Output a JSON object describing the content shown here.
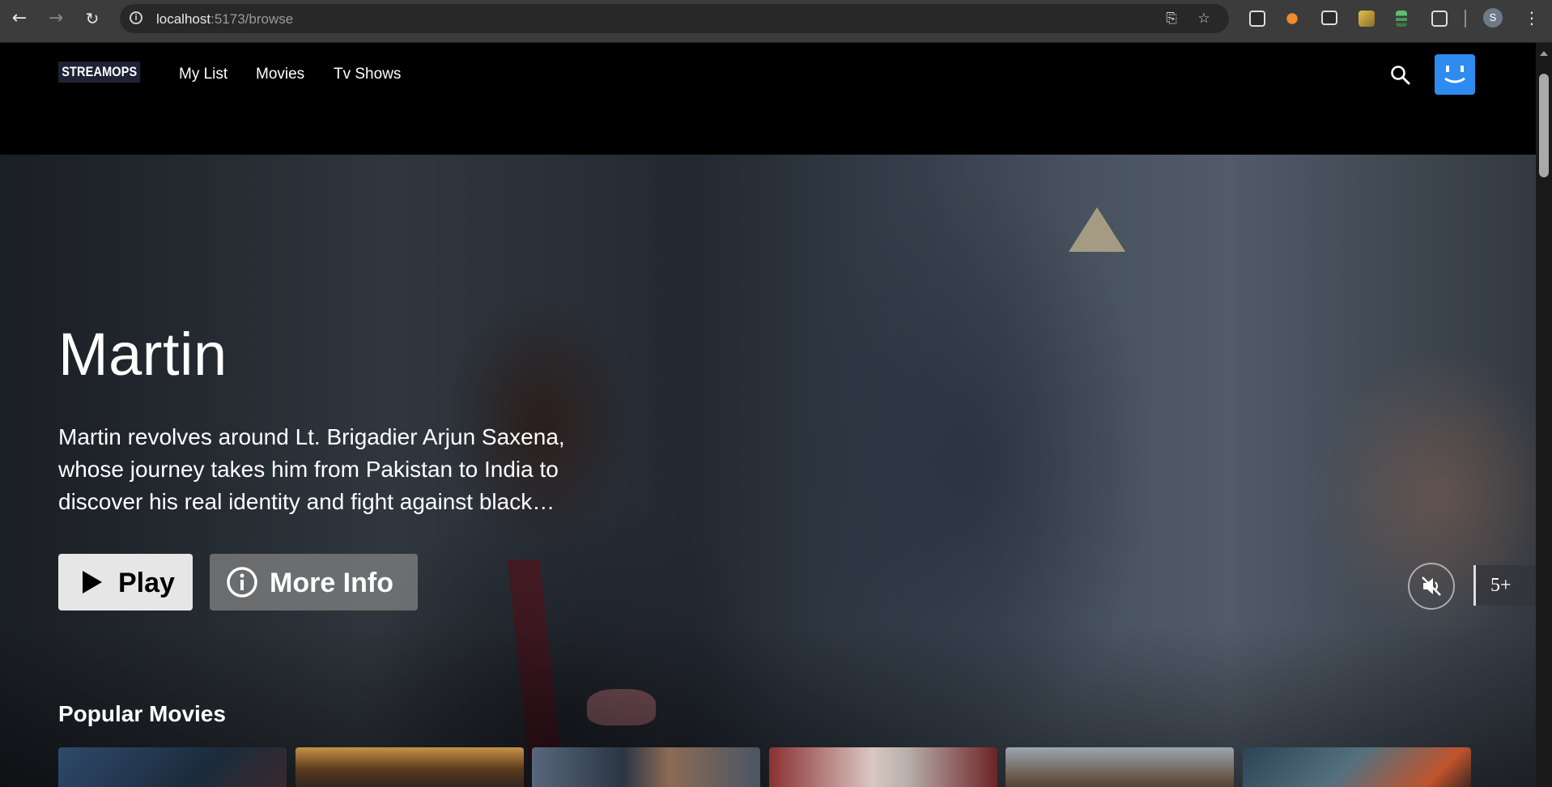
{
  "browser": {
    "url_host": "localhost",
    "url_rest": ":5173/browse",
    "profile_initial": "S"
  },
  "header": {
    "logo": "STREAMOPS",
    "nav": [
      "My List",
      "Movies",
      "Tv Shows"
    ]
  },
  "hero": {
    "title": "Martin",
    "description": "Martin revolves around Lt. Brigadier Arjun Saxena, whose journey takes him from Pakistan to India to discover his real identity and fight against black…",
    "play_label": "Play",
    "info_label": "More Info",
    "rating": "5+"
  },
  "rows": [
    {
      "title": "Popular Movies"
    }
  ],
  "colors": {
    "accent_avatar": "#2e8bf0",
    "logo_bg": "#1e2235",
    "play_bg": "#e6e6e6"
  },
  "icons": [
    "back-icon",
    "forward-icon",
    "reload-icon",
    "info-icon",
    "install-icon",
    "star-icon",
    "search-icon",
    "volume-muted-icon",
    "play-icon"
  ]
}
